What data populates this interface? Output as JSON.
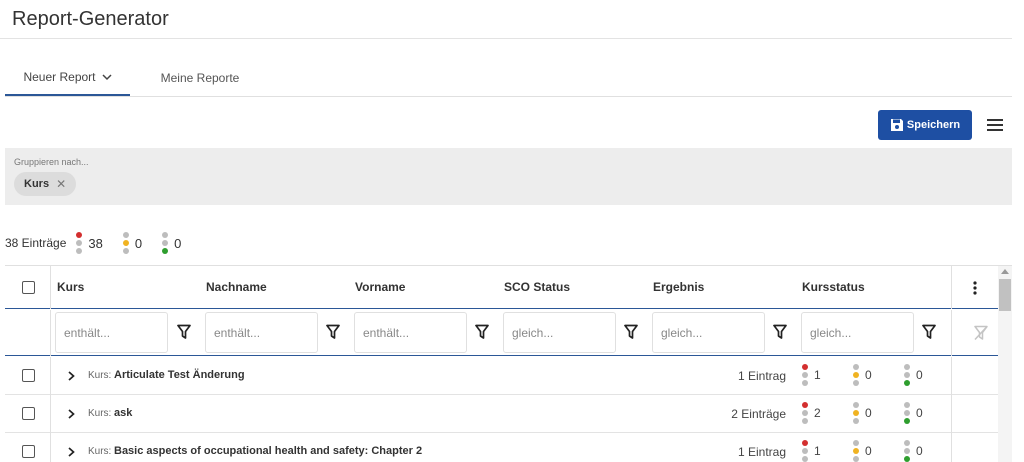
{
  "page": {
    "title": "Report-Generator"
  },
  "tabs": [
    {
      "label": "Neuer Report"
    },
    {
      "label": "Meine Reporte"
    }
  ],
  "toolbar": {
    "save_label": "Speichern"
  },
  "grouping": {
    "label": "Gruppieren nach...",
    "chip": "Kurs"
  },
  "summary": {
    "entries_label": "38 Einträge",
    "red": "38",
    "yellow": "0",
    "green": "0"
  },
  "columns": [
    "Kurs",
    "Nachname",
    "Vorname",
    "SCO Status",
    "Ergebnis",
    "Kursstatus"
  ],
  "filters": [
    "enthält...",
    "enthält...",
    "enthält...",
    "gleich...",
    "gleich...",
    "gleich..."
  ],
  "rows": [
    {
      "prefix": "Kurs:",
      "name": "Articulate Test Änderung",
      "entries": "1 Eintrag",
      "red": "1",
      "yellow": "0",
      "green": "0"
    },
    {
      "prefix": "Kurs:",
      "name": "ask",
      "entries": "2 Einträge",
      "red": "2",
      "yellow": "0",
      "green": "0"
    },
    {
      "prefix": "Kurs:",
      "name": "Basic aspects of occupational health and safety: Chapter 2",
      "entries": "1 Eintrag",
      "red": "1",
      "yellow": "0",
      "green": "0"
    }
  ],
  "colors": {
    "accent": "#2b5797",
    "button": "#1e4fa3",
    "red": "#d32f2f",
    "yellow": "#f0b322",
    "green": "#2e9e2e",
    "grey": "#bdbdbd"
  }
}
